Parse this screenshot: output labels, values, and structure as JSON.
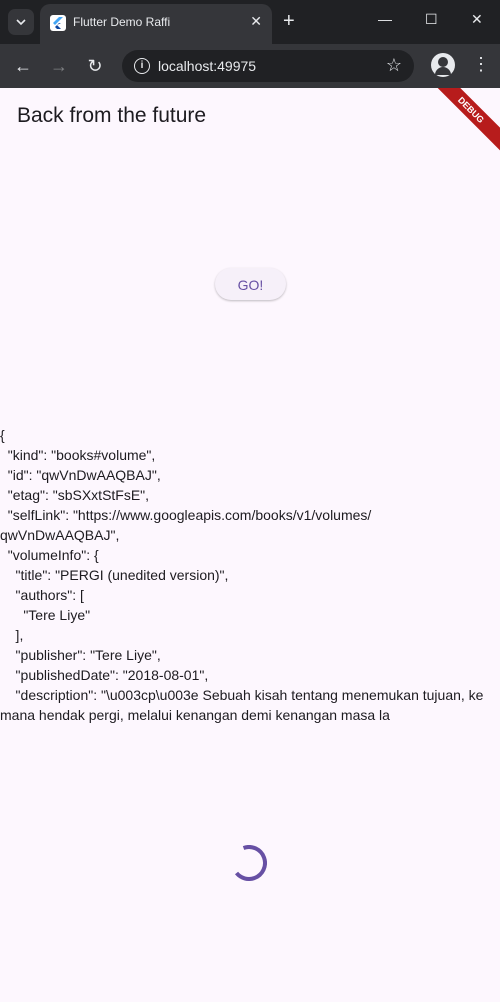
{
  "browser": {
    "tab_title": "Flutter Demo Raffi",
    "url": "localhost:49975"
  },
  "app": {
    "title": "Back from the future",
    "debug_banner": "DEBUG",
    "go_button": "GO!",
    "result_lines": [
      "{",
      "  \"kind\": \"books#volume\",",
      "  \"id\": \"qwVnDwAAQBAJ\",",
      "  \"etag\": \"sbSXxtStFsE\",",
      "  \"selfLink\": \"https://www.googleapis.com/books/v1/volumes/",
      "qwVnDwAAQBAJ\",",
      "  \"volumeInfo\": {",
      "    \"title\": \"PERGI (unedited version)\",",
      "    \"authors\": [",
      "      \"Tere Liye\"",
      "    ],",
      "    \"publisher\": \"Tere Liye\",",
      "    \"publishedDate\": \"2018-08-01\",",
      "    \"description\": \"\\u003cp\\u003e Sebuah kisah tentang menemukan tujuan, ke",
      "mana hendak pergi, melalui kenangan demi kenangan masa la"
    ]
  }
}
